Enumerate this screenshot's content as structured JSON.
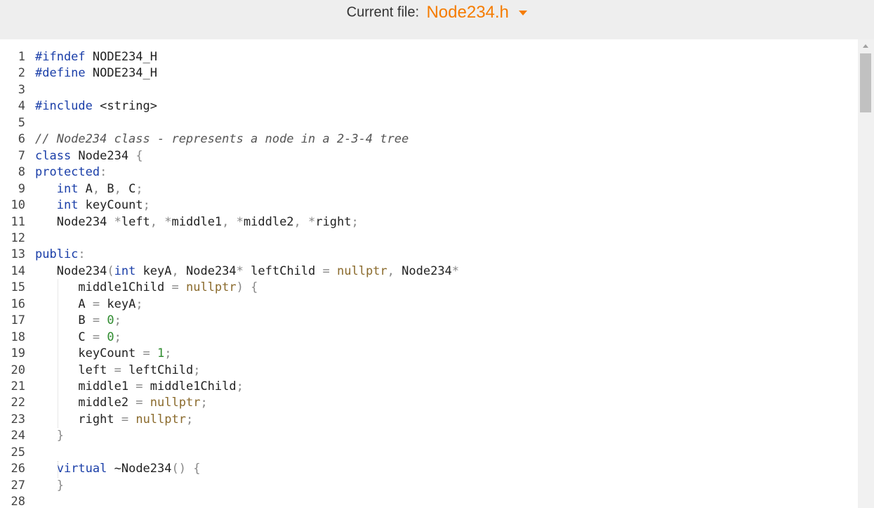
{
  "header": {
    "file_label": "Current file:",
    "file_name": "Node234.h",
    "dropdown_icon": "caret-down-icon",
    "accent_color": "#f57c00"
  },
  "editor": {
    "line_numbers": [
      "1",
      "2",
      "3",
      "4",
      "5",
      "6",
      "7",
      "8",
      "9",
      "10",
      "11",
      "12",
      "13",
      "14",
      "15",
      "16",
      "17",
      "18",
      "19",
      "20",
      "21",
      "22",
      "23",
      "24",
      "25",
      "26",
      "27",
      "28"
    ],
    "lines": [
      [
        [
          "#ifndef",
          "kw"
        ],
        [
          " NODE234_H",
          "tx"
        ]
      ],
      [
        [
          "#define",
          "kw"
        ],
        [
          " NODE234_H",
          "tx"
        ]
      ],
      [],
      [
        [
          "#include",
          "kw"
        ],
        [
          " <string>",
          "tx"
        ]
      ],
      [],
      [
        [
          "// Node234 class - represents a node in a 2-3-4 tree",
          "cm"
        ]
      ],
      [
        [
          "class",
          "kw"
        ],
        [
          " Node234 ",
          "tx"
        ],
        [
          "{",
          "pn"
        ]
      ],
      [
        [
          "protected",
          "kw"
        ],
        [
          ":",
          "pn"
        ]
      ],
      [
        [
          "   ",
          "tx"
        ],
        [
          "int",
          "kw"
        ],
        [
          " A",
          "tx"
        ],
        [
          ",",
          "pn"
        ],
        [
          " B",
          "tx"
        ],
        [
          ",",
          "pn"
        ],
        [
          " C",
          "tx"
        ],
        [
          ";",
          "pn"
        ]
      ],
      [
        [
          "   ",
          "tx"
        ],
        [
          "int",
          "kw"
        ],
        [
          " keyCount",
          "tx"
        ],
        [
          ";",
          "pn"
        ]
      ],
      [
        [
          "   Node234 ",
          "tx"
        ],
        [
          "*",
          "pn"
        ],
        [
          "left",
          "tx"
        ],
        [
          ", *",
          "pn"
        ],
        [
          "middle1",
          "tx"
        ],
        [
          ", *",
          "pn"
        ],
        [
          "middle2",
          "tx"
        ],
        [
          ", *",
          "pn"
        ],
        [
          "right",
          "tx"
        ],
        [
          ";",
          "pn"
        ]
      ],
      [],
      [
        [
          "public",
          "kw"
        ],
        [
          ":",
          "pn"
        ]
      ],
      [
        [
          "   Node234",
          "tx"
        ],
        [
          "(",
          "pn"
        ],
        [
          "int",
          "kw"
        ],
        [
          " keyA",
          "tx"
        ],
        [
          ",",
          "pn"
        ],
        [
          " Node234",
          "tx"
        ],
        [
          "*",
          "pn"
        ],
        [
          " leftChild ",
          "tx"
        ],
        [
          "=",
          "pn"
        ],
        [
          " ",
          "tx"
        ],
        [
          "nullptr",
          "nl"
        ],
        [
          ",",
          "pn"
        ],
        [
          " Node234",
          "tx"
        ],
        [
          "*",
          "pn"
        ]
      ],
      [
        [
          "      middle1Child ",
          "tx"
        ],
        [
          "=",
          "pn"
        ],
        [
          " ",
          "tx"
        ],
        [
          "nullptr",
          "nl"
        ],
        [
          ") {",
          "pn"
        ]
      ],
      [
        [
          "      A ",
          "tx"
        ],
        [
          "=",
          "pn"
        ],
        [
          " keyA",
          "tx"
        ],
        [
          ";",
          "pn"
        ]
      ],
      [
        [
          "      B ",
          "tx"
        ],
        [
          "=",
          "pn"
        ],
        [
          " ",
          "tx"
        ],
        [
          "0",
          "num"
        ],
        [
          ";",
          "pn"
        ]
      ],
      [
        [
          "      C ",
          "tx"
        ],
        [
          "=",
          "pn"
        ],
        [
          " ",
          "tx"
        ],
        [
          "0",
          "num"
        ],
        [
          ";",
          "pn"
        ]
      ],
      [
        [
          "      keyCount ",
          "tx"
        ],
        [
          "=",
          "pn"
        ],
        [
          " ",
          "tx"
        ],
        [
          "1",
          "num"
        ],
        [
          ";",
          "pn"
        ]
      ],
      [
        [
          "      left ",
          "tx"
        ],
        [
          "=",
          "pn"
        ],
        [
          " leftChild",
          "tx"
        ],
        [
          ";",
          "pn"
        ]
      ],
      [
        [
          "      middle1 ",
          "tx"
        ],
        [
          "=",
          "pn"
        ],
        [
          " middle1Child",
          "tx"
        ],
        [
          ";",
          "pn"
        ]
      ],
      [
        [
          "      middle2 ",
          "tx"
        ],
        [
          "=",
          "pn"
        ],
        [
          " ",
          "tx"
        ],
        [
          "nullptr",
          "nl"
        ],
        [
          ";",
          "pn"
        ]
      ],
      [
        [
          "      right ",
          "tx"
        ],
        [
          "=",
          "pn"
        ],
        [
          " ",
          "tx"
        ],
        [
          "nullptr",
          "nl"
        ],
        [
          ";",
          "pn"
        ]
      ],
      [
        [
          "   ",
          "tx"
        ],
        [
          "}",
          "pn"
        ]
      ],
      [],
      [
        [
          "   ",
          "tx"
        ],
        [
          "virtual",
          "kw"
        ],
        [
          " ~Node234",
          "tx"
        ],
        [
          "() {",
          "pn"
        ]
      ],
      [
        [
          "   ",
          "tx"
        ],
        [
          "}",
          "pn"
        ]
      ],
      []
    ]
  },
  "scrollbar": {
    "up_icon": "scroll-up-arrow-icon"
  }
}
